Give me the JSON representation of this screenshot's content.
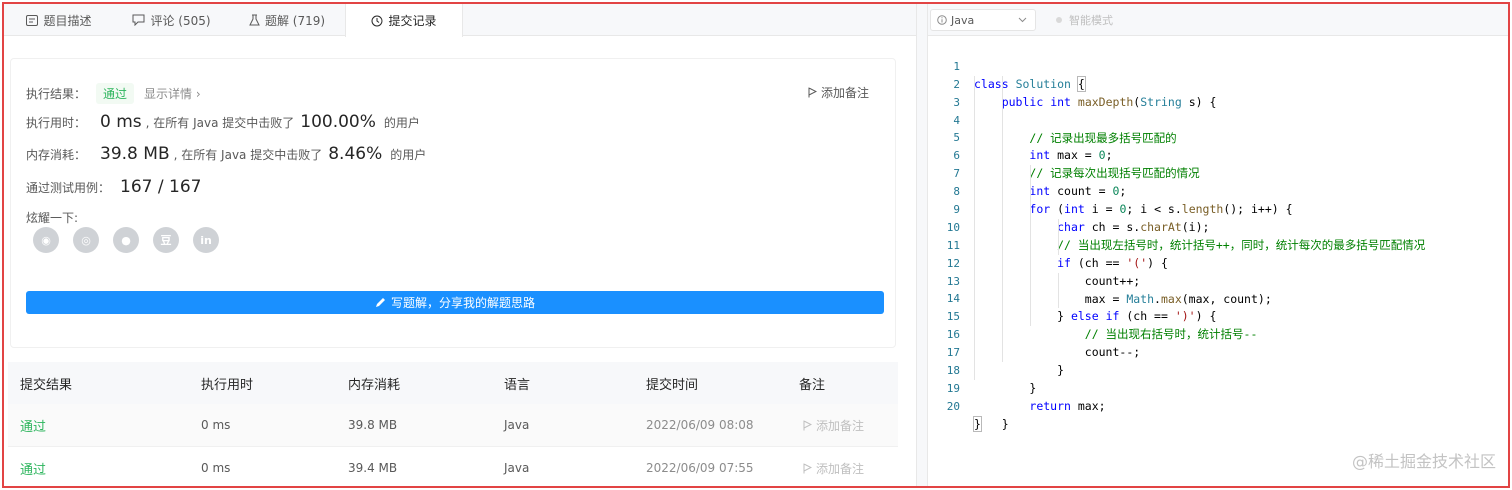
{
  "tabs": [
    {
      "label": "题目描述",
      "icon": "description-icon"
    },
    {
      "label": "评论 (505)",
      "icon": "comment-icon"
    },
    {
      "label": "题解 (719)",
      "icon": "flask-icon"
    },
    {
      "label": "提交记录",
      "icon": "clock-icon",
      "active": true
    }
  ],
  "result": {
    "exec_result_label": "执行结果：",
    "exec_result_value": "通过",
    "show_detail": "显示详情 ›",
    "add_note": "添加备注",
    "time_label": "执行用时：",
    "time_value": "0 ms",
    "time_beat_text": ", 在所有 Java 提交中击败了",
    "time_pct": "100.00%",
    "time_users": "的用户",
    "mem_label": "内存消耗：",
    "mem_value": "39.8 MB",
    "mem_beat_text": ", 在所有 Java 提交中击败了",
    "mem_pct": "8.46%",
    "mem_users": "的用户",
    "tests_label": "通过测试用例：",
    "tests_value": "167 / 167",
    "share_label": "炫耀一下:",
    "share_icons": [
      {
        "icon": "wechat-icon",
        "glyph": "◉"
      },
      {
        "icon": "weibo-icon",
        "glyph": "◎"
      },
      {
        "icon": "qq-icon",
        "glyph": "●"
      },
      {
        "icon": "douban-icon",
        "glyph": "豆"
      },
      {
        "icon": "linkedin-icon",
        "glyph": "in"
      }
    ],
    "write_solution": "写题解，分享我的解题思路"
  },
  "table": {
    "headers": [
      "提交结果",
      "执行用时",
      "内存消耗",
      "语言",
      "提交时间",
      "备注"
    ],
    "rows": [
      {
        "status": "通过",
        "time": "0 ms",
        "memory": "39.8 MB",
        "lang": "Java",
        "submitted": "2022/06/09 08:08",
        "note": "添加备注"
      },
      {
        "status": "通过",
        "time": "0 ms",
        "memory": "39.4 MB",
        "lang": "Java",
        "submitted": "2022/06/09 07:55",
        "note": "添加备注"
      }
    ]
  },
  "editor": {
    "language": "Java",
    "smart_mode": "智能模式",
    "line_numbers": [
      "1",
      "2",
      "3",
      "4",
      "5",
      "6",
      "7",
      "8",
      "9",
      "10",
      "11",
      "12",
      "13",
      "14",
      "15",
      "16",
      "17",
      "18",
      "19",
      "20"
    ]
  },
  "watermark": "@稀土掘金技术社区",
  "colors": {
    "accent_blue": "#1a90ff",
    "pass_green": "#2db55d",
    "frame_red": "#e24444"
  }
}
